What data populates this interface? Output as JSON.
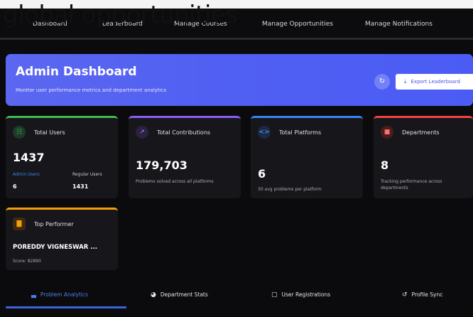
{
  "overlay_title": "global opportunities",
  "nav": {
    "items": [
      "Dashboard",
      "Leaderboard",
      "Manage Courses",
      "Manage Opportunities",
      "Manage Notifications"
    ]
  },
  "banner": {
    "title": "Admin Dashboard",
    "subtitle": "Monitor user performance metrics and department analytics",
    "refresh_icon": "refresh-icon",
    "export_label": "Export Leaderboard"
  },
  "cards": {
    "total_users": {
      "title": "Total Users",
      "value": "1437",
      "admin_label": "Admin Users",
      "admin_value": "6",
      "regular_label": "Regular Users",
      "regular_value": "1431",
      "accent": "#3fb950"
    },
    "total_contributions": {
      "title": "Total Contributions",
      "value": "179,703",
      "desc": "Problems solved across all platforms",
      "accent": "#8b5cf6"
    },
    "total_platforms": {
      "title": "Total Platforms",
      "value": "6",
      "desc": "30 avg problems per platform",
      "accent": "#3b82f6"
    },
    "departments": {
      "title": "Departments",
      "value": "8",
      "desc": "Tracking performance across departments",
      "accent": "#ef4444"
    },
    "top_performer": {
      "title": "Top Performer",
      "name": "POREDDY VIGNESWAR ...",
      "score": "Score: 82890",
      "accent": "#f59e0b"
    }
  },
  "tabs": [
    {
      "label": "Problem Analytics",
      "icon": "bar-chart-icon",
      "active": true
    },
    {
      "label": "Department Stats",
      "icon": "pie-chart-icon",
      "active": false
    },
    {
      "label": "User Registrations",
      "icon": "calendar-icon",
      "active": false
    },
    {
      "label": "Profile Sync",
      "icon": "sync-icon",
      "active": false
    }
  ]
}
